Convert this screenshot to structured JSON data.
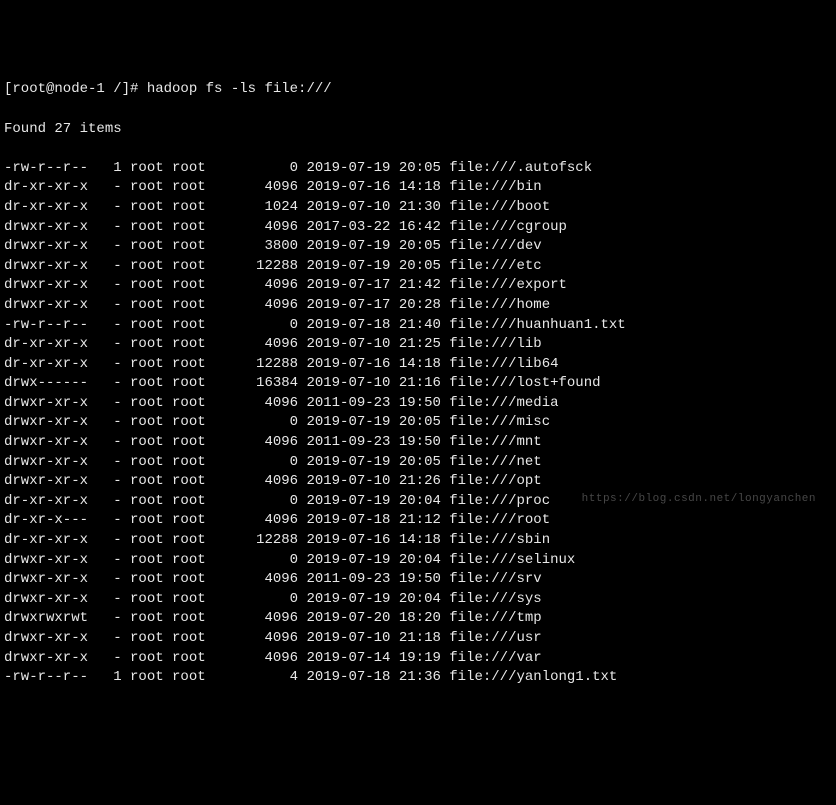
{
  "prompt": {
    "user_host": "[root@node-1 /]#",
    "command": "hadoop fs -ls file:///"
  },
  "summary": "Found 27 items",
  "listing": [
    {
      "perms": "-rw-r--r--",
      "repl": "1",
      "owner": "root",
      "group": "root",
      "size": "0",
      "date": "2019-07-19",
      "time": "20:05",
      "path": "file:///.autofsck"
    },
    {
      "perms": "dr-xr-xr-x",
      "repl": "-",
      "owner": "root",
      "group": "root",
      "size": "4096",
      "date": "2019-07-16",
      "time": "14:18",
      "path": "file:///bin"
    },
    {
      "perms": "dr-xr-xr-x",
      "repl": "-",
      "owner": "root",
      "group": "root",
      "size": "1024",
      "date": "2019-07-10",
      "time": "21:30",
      "path": "file:///boot"
    },
    {
      "perms": "drwxr-xr-x",
      "repl": "-",
      "owner": "root",
      "group": "root",
      "size": "4096",
      "date": "2017-03-22",
      "time": "16:42",
      "path": "file:///cgroup"
    },
    {
      "perms": "drwxr-xr-x",
      "repl": "-",
      "owner": "root",
      "group": "root",
      "size": "3800",
      "date": "2019-07-19",
      "time": "20:05",
      "path": "file:///dev"
    },
    {
      "perms": "drwxr-xr-x",
      "repl": "-",
      "owner": "root",
      "group": "root",
      "size": "12288",
      "date": "2019-07-19",
      "time": "20:05",
      "path": "file:///etc"
    },
    {
      "perms": "drwxr-xr-x",
      "repl": "-",
      "owner": "root",
      "group": "root",
      "size": "4096",
      "date": "2019-07-17",
      "time": "21:42",
      "path": "file:///export"
    },
    {
      "perms": "drwxr-xr-x",
      "repl": "-",
      "owner": "root",
      "group": "root",
      "size": "4096",
      "date": "2019-07-17",
      "time": "20:28",
      "path": "file:///home"
    },
    {
      "perms": "-rw-r--r--",
      "repl": "-",
      "owner": "root",
      "group": "root",
      "size": "0",
      "date": "2019-07-18",
      "time": "21:40",
      "path": "file:///huanhuan1.txt"
    },
    {
      "perms": "dr-xr-xr-x",
      "repl": "-",
      "owner": "root",
      "group": "root",
      "size": "4096",
      "date": "2019-07-10",
      "time": "21:25",
      "path": "file:///lib"
    },
    {
      "perms": "dr-xr-xr-x",
      "repl": "-",
      "owner": "root",
      "group": "root",
      "size": "12288",
      "date": "2019-07-16",
      "time": "14:18",
      "path": "file:///lib64"
    },
    {
      "perms": "drwx------",
      "repl": "-",
      "owner": "root",
      "group": "root",
      "size": "16384",
      "date": "2019-07-10",
      "time": "21:16",
      "path": "file:///lost+found"
    },
    {
      "perms": "drwxr-xr-x",
      "repl": "-",
      "owner": "root",
      "group": "root",
      "size": "4096",
      "date": "2011-09-23",
      "time": "19:50",
      "path": "file:///media"
    },
    {
      "perms": "drwxr-xr-x",
      "repl": "-",
      "owner": "root",
      "group": "root",
      "size": "0",
      "date": "2019-07-19",
      "time": "20:05",
      "path": "file:///misc"
    },
    {
      "perms": "drwxr-xr-x",
      "repl": "-",
      "owner": "root",
      "group": "root",
      "size": "4096",
      "date": "2011-09-23",
      "time": "19:50",
      "path": "file:///mnt"
    },
    {
      "perms": "drwxr-xr-x",
      "repl": "-",
      "owner": "root",
      "group": "root",
      "size": "0",
      "date": "2019-07-19",
      "time": "20:05",
      "path": "file:///net"
    },
    {
      "perms": "drwxr-xr-x",
      "repl": "-",
      "owner": "root",
      "group": "root",
      "size": "4096",
      "date": "2019-07-10",
      "time": "21:26",
      "path": "file:///opt"
    },
    {
      "perms": "dr-xr-xr-x",
      "repl": "-",
      "owner": "root",
      "group": "root",
      "size": "0",
      "date": "2019-07-19",
      "time": "20:04",
      "path": "file:///proc"
    },
    {
      "perms": "dr-xr-x---",
      "repl": "-",
      "owner": "root",
      "group": "root",
      "size": "4096",
      "date": "2019-07-18",
      "time": "21:12",
      "path": "file:///root"
    },
    {
      "perms": "dr-xr-xr-x",
      "repl": "-",
      "owner": "root",
      "group": "root",
      "size": "12288",
      "date": "2019-07-16",
      "time": "14:18",
      "path": "file:///sbin"
    },
    {
      "perms": "drwxr-xr-x",
      "repl": "-",
      "owner": "root",
      "group": "root",
      "size": "0",
      "date": "2019-07-19",
      "time": "20:04",
      "path": "file:///selinux"
    },
    {
      "perms": "drwxr-xr-x",
      "repl": "-",
      "owner": "root",
      "group": "root",
      "size": "4096",
      "date": "2011-09-23",
      "time": "19:50",
      "path": "file:///srv"
    },
    {
      "perms": "drwxr-xr-x",
      "repl": "-",
      "owner": "root",
      "group": "root",
      "size": "0",
      "date": "2019-07-19",
      "time": "20:04",
      "path": "file:///sys"
    },
    {
      "perms": "drwxrwxrwt",
      "repl": "-",
      "owner": "root",
      "group": "root",
      "size": "4096",
      "date": "2019-07-20",
      "time": "18:20",
      "path": "file:///tmp"
    },
    {
      "perms": "drwxr-xr-x",
      "repl": "-",
      "owner": "root",
      "group": "root",
      "size": "4096",
      "date": "2019-07-10",
      "time": "21:18",
      "path": "file:///usr"
    },
    {
      "perms": "drwxr-xr-x",
      "repl": "-",
      "owner": "root",
      "group": "root",
      "size": "4096",
      "date": "2019-07-14",
      "time": "19:19",
      "path": "file:///var"
    },
    {
      "perms": "-rw-r--r--",
      "repl": "1",
      "owner": "root",
      "group": "root",
      "size": "4",
      "date": "2019-07-18",
      "time": "21:36",
      "path": "file:///yanlong1.txt"
    }
  ],
  "watermark": "https://blog.csdn.net/longyanchen"
}
